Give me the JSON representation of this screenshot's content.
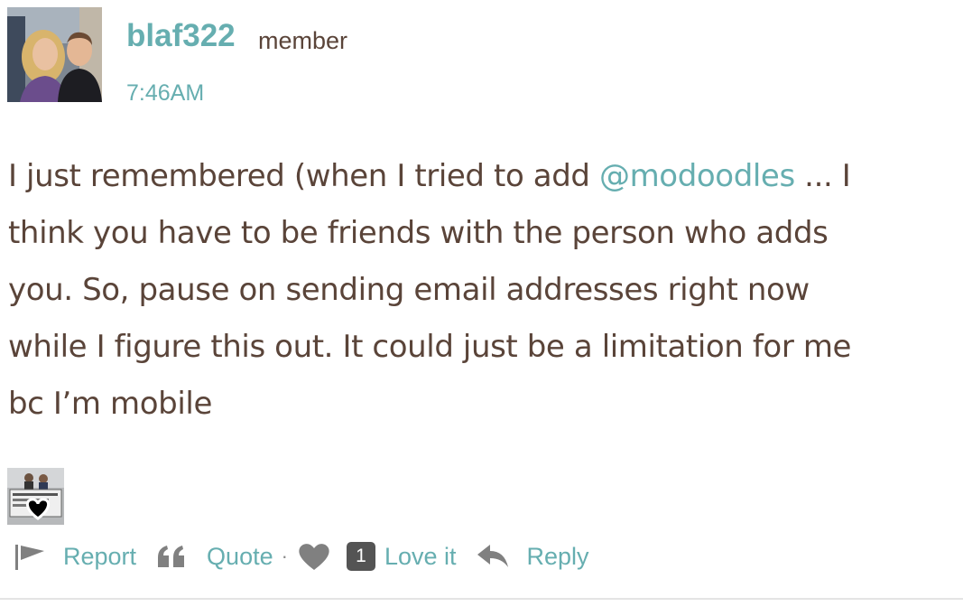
{
  "post": {
    "author": {
      "username": "blaf322",
      "role": "member",
      "avatar_icon": "profile-photo"
    },
    "timestamp": "7:46AM",
    "body": {
      "line1_before": "I just remembered (when I tried to add ",
      "mention": "@modoodles",
      "line1_after": " ... I",
      "line2": "think you have to be friends with the person who adds",
      "line3": "you. So, pause on sending email addresses right now",
      "line4": "while I figure this out. It could just be a limitation for me",
      "line5": "bc I’m mobile"
    },
    "reactions": {
      "avatar_icon": "reactor-photo-with-heart"
    },
    "actions": {
      "report_label": "Report",
      "quote_label": "Quote",
      "separator": "·",
      "love_count": "1",
      "love_label": "Love it",
      "reply_label": "Reply"
    }
  },
  "colors": {
    "accent": "#66aeb0",
    "text": "#5a4439",
    "icon": "#808080",
    "badge": "#545454"
  }
}
